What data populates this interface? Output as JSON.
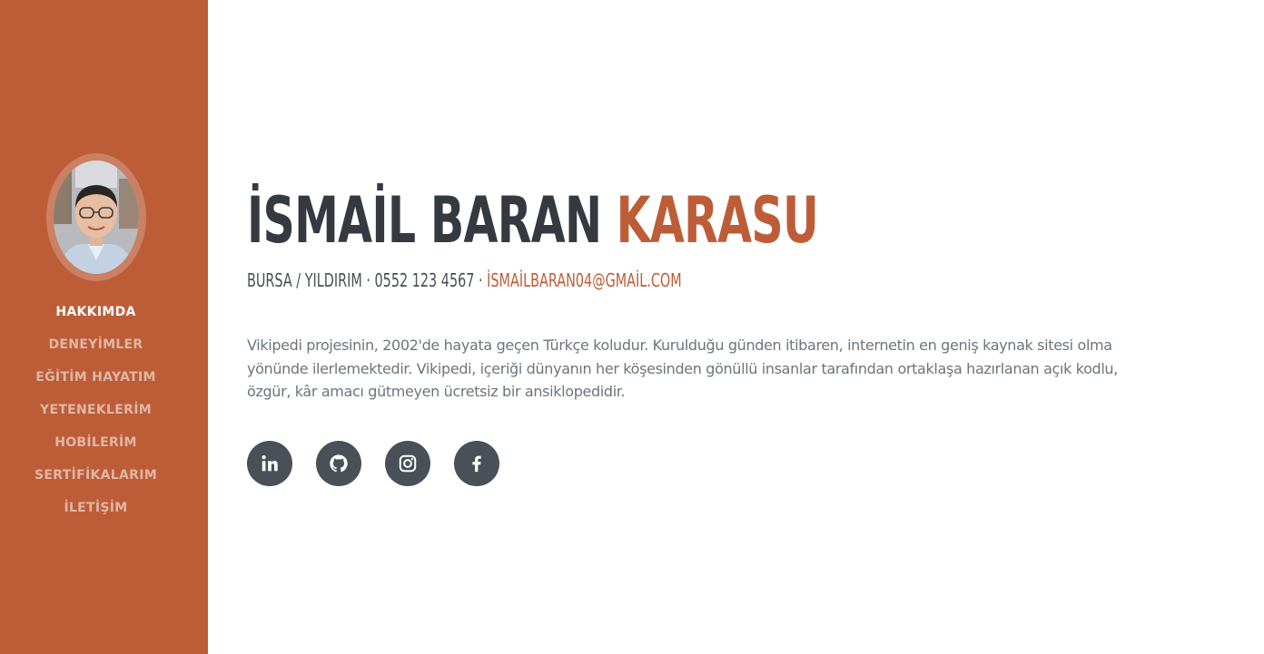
{
  "sidebar": {
    "avatar_alt": "profile photo",
    "nav": [
      {
        "label": "HAKKIMDA",
        "active": true
      },
      {
        "label": "DENEYİMLER",
        "active": false
      },
      {
        "label": "EĞİTİM HAYATIM",
        "active": false
      },
      {
        "label": "YETENEKLERİM",
        "active": false
      },
      {
        "label": "HOBİLERİM",
        "active": false
      },
      {
        "label": "SERTİFİKALARIM",
        "active": false
      },
      {
        "label": "İLETİŞİM",
        "active": false
      }
    ]
  },
  "main": {
    "first_name": "İSMAİL BARAN",
    "last_name": "KARASU",
    "location_phone": "BURSA / YILDIRIM · 0552 123 4567 ·",
    "email": "İSMAİLBARAN04@GMAİL.COM",
    "about": "Vikipedi projesinin, 2002'de hayata geçen Türkçe koludur. Kurulduğu günden itibaren, internetin en geniş kaynak sitesi olma yönünde ilerlemektedir. Vikipedi, içeriği dünyanın her köşesinden gönüllü insanlar tarafından ortaklaşa hazırlanan açık kodlu, özgür, kâr amacı gütmeyen ücretsiz bir ansiklopedidir.",
    "social": [
      {
        "icon": "linkedin-icon"
      },
      {
        "icon": "github-icon"
      },
      {
        "icon": "instagram-icon"
      },
      {
        "icon": "facebook-icon"
      }
    ]
  },
  "colors": {
    "accent": "#bd5d38",
    "heading": "#343a40",
    "text": "#6c757d",
    "social_bg": "#495057"
  }
}
